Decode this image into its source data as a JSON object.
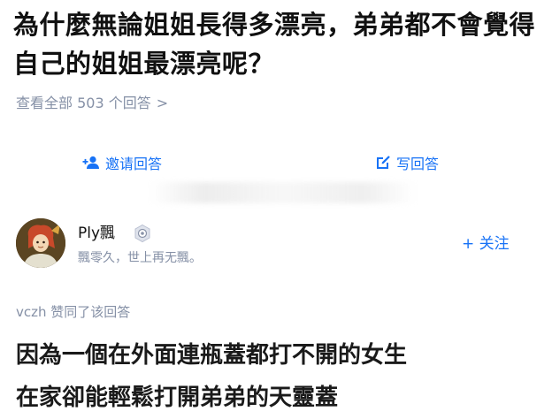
{
  "question": {
    "title": "為什麼無論姐姐長得多漂亮，弟弟都不會覺得自己的姐姐最漂亮呢？",
    "view_all": "查看全部 503 个回答",
    "view_all_chevron": ">"
  },
  "actions": {
    "invite_label": "邀请回答",
    "invite_icon": "add-user-icon",
    "write_label": "写回答",
    "write_icon": "edit-icon"
  },
  "author": {
    "name": "Ply飄",
    "bio": "飄零久，世上再无飄。",
    "badge_icon": "verified-badge-icon",
    "follow_label": "+ 关注"
  },
  "upvote_line": "vczh 赞同了该回答",
  "answer": {
    "lines": [
      "因為一個在外面連瓶蓋都打不開的女生",
      "在家卻能輕鬆打開弟弟的天靈蓋"
    ]
  },
  "colors": {
    "accent_blue": "#1772f6",
    "muted_gray": "#8590a6",
    "text_dark": "#121212"
  }
}
